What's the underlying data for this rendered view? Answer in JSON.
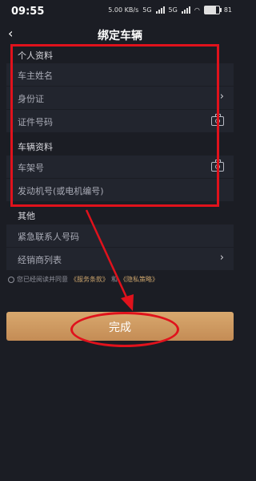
{
  "status_bar": {
    "time": "09:55",
    "net_speed": "5.00 KB/s",
    "network_1": "5G",
    "network_2": "5G",
    "battery": "81",
    "battery_level": 0.81
  },
  "header": {
    "back_icon": "chevron-left",
    "title": "绑定车辆"
  },
  "sections": {
    "personal": {
      "title": "个人资料",
      "rows": [
        "车主姓名",
        "身份证",
        "证件号码"
      ]
    },
    "vehicle": {
      "title": "车辆资料",
      "rows": [
        "车架号",
        "发动机号(或电机编号)"
      ]
    },
    "other": {
      "title": "其他",
      "rows": [
        "紧急联系人号码",
        "经销商列表"
      ]
    }
  },
  "agreement": {
    "prefix": "您已经阅读并同意",
    "terms": "《服务条款》",
    "and": "和",
    "privacy": "《隐私策略》"
  },
  "done_button": {
    "label": "完成"
  },
  "annotation": {
    "color": "#e0121c"
  }
}
